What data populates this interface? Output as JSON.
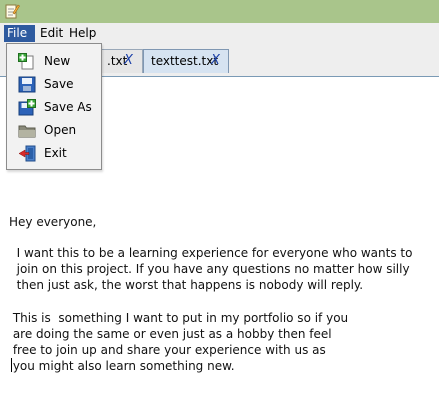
{
  "window": {
    "app_icon": "notepad-icon"
  },
  "menubar": {
    "file": "File",
    "edit": "Edit",
    "help": "Help"
  },
  "tabs": [
    {
      "label": ".txt",
      "close": "X"
    },
    {
      "label": "texttest.txt",
      "close": "X"
    }
  ],
  "file_menu": [
    {
      "label": "New",
      "icon": "new-document-icon"
    },
    {
      "label": "Save",
      "icon": "save-icon"
    },
    {
      "label": "Save As",
      "icon": "save-as-icon"
    },
    {
      "label": "Open",
      "icon": "folder-icon"
    },
    {
      "label": "Exit",
      "icon": "exit-door-icon"
    }
  ],
  "editor": {
    "paragraphs": [
      "Hey everyone,",
      "  I want this to be a learning experience for everyone who wants to\n  join on this project. If you have any questions no matter how silly\n  then just ask, the worst that happens is nobody will reply.",
      " This is  something I want to put in my portfolio so if you\n are doing the same or even just as a hobby then feel\n free to join up and share your experience with us as\n you might also learn something new."
    ]
  },
  "colors": {
    "titlebar": "#a9c58b",
    "menu_active": "#2e5a9f",
    "tab_accent": "#2e6cc5"
  }
}
